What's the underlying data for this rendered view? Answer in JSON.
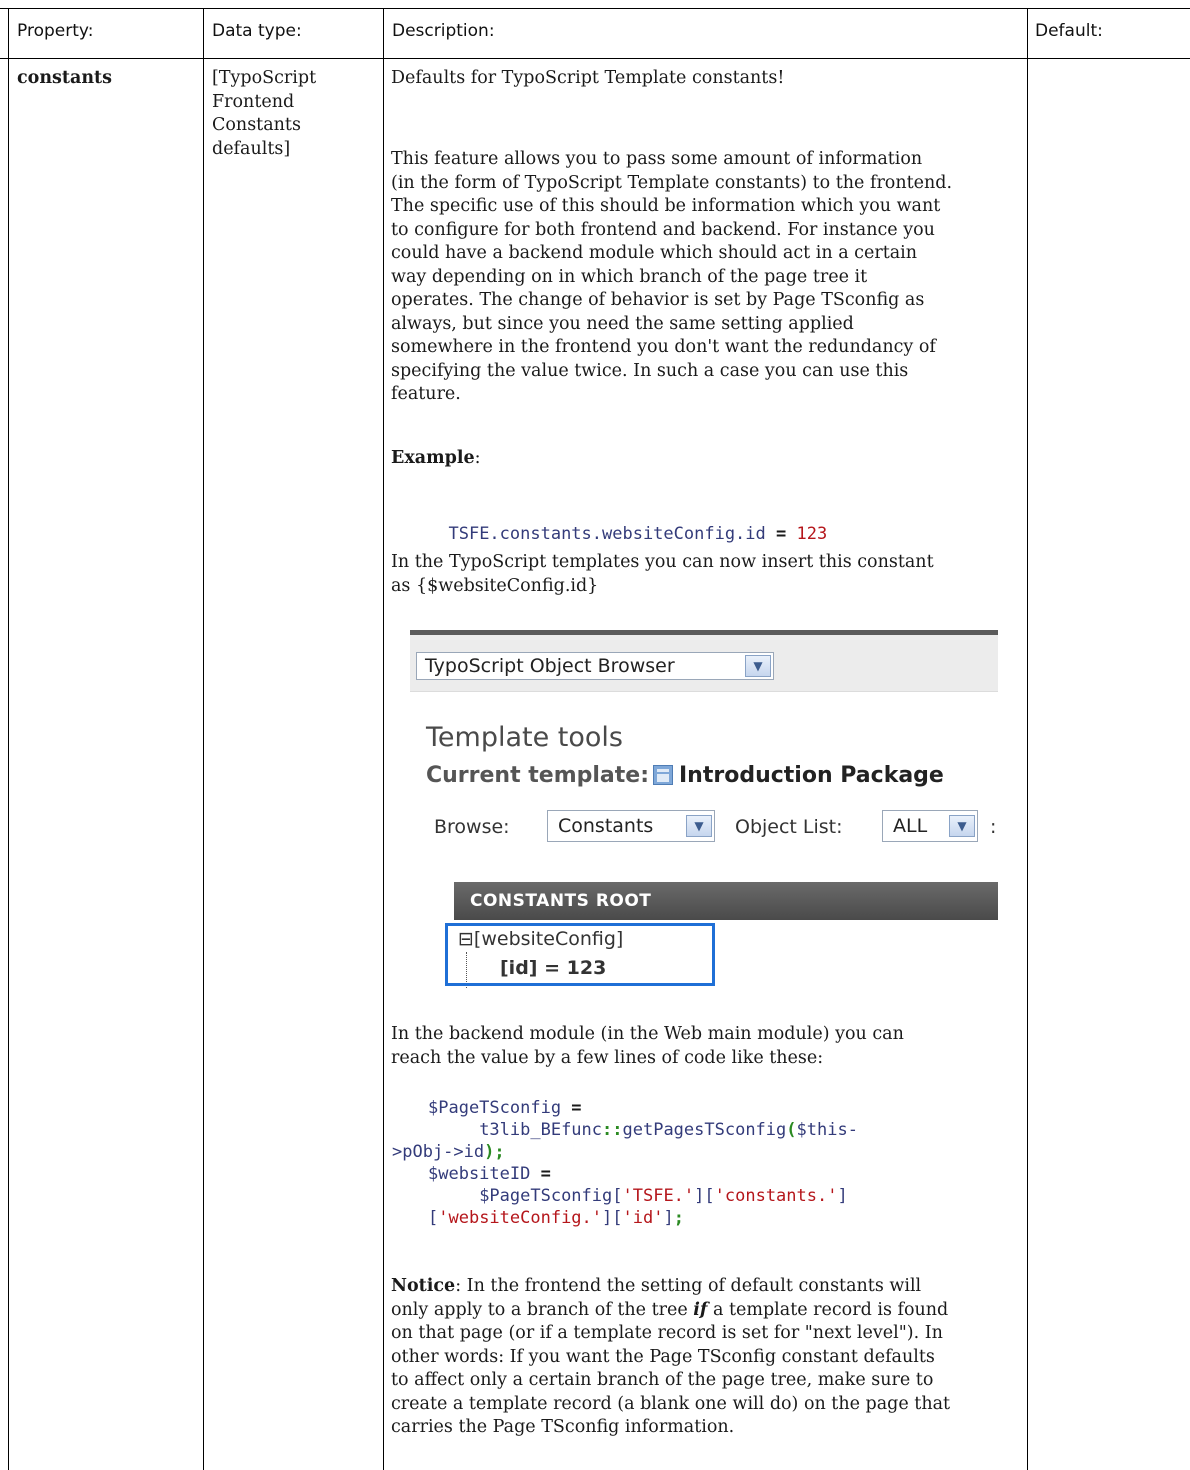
{
  "headers": {
    "property": "Property:",
    "datatype": "Data type:",
    "description": "Description:",
    "default": "Default:"
  },
  "row": {
    "property": "constants",
    "datatype_lines": [
      "[TypoScript",
      "Frontend",
      "Constants",
      "defaults]"
    ],
    "p1": "Defaults for TypoScript Template constants!",
    "p2_lines": [
      "This feature allows you to pass some amount of information",
      "(in the form of TypoScript Template constants) to the frontend.",
      "The specific use of this should be information which you want",
      "to configure for both frontend and backend. For instance you",
      "could have a backend module which should act in a certain",
      "way depending on in which branch of the page tree it",
      "operates. The change of behavior is set by Page TSconfig as",
      "always, but since you need the same setting applied",
      "somewhere in the frontend you don't want the redundancy of",
      "specifying the value twice. In such a case you can use this",
      "feature."
    ],
    "example_label": "Example",
    "example_colon": ":",
    "code1": {
      "key": "TSFE.constants.websiteConfig.id",
      "op": " = ",
      "value": "123"
    },
    "p3_lines": [
      "In the TypoScript templates you can now insert this constant",
      "as {$websiteConfig.id}"
    ],
    "p4_lines": [
      "In the backend module (in the Web main module) you can",
      "reach the value by a few lines of code like these:"
    ],
    "code2": {
      "l1_var": "$PageTSconfig",
      "l1_op": " =",
      "l2_indent": "     ",
      "l2_fn": "t3lib_BEfunc",
      "l2_sep": "::",
      "l2_method": "getPagesTSconfig",
      "l2_paren": "(",
      "l2_arg": "$this-",
      "l3_arg": ">pObj->id",
      "l3_end": ");",
      "l4_var": "$websiteID",
      "l4_op": " =",
      "l5_indent": "     ",
      "l5_var": "$PageTSconfig",
      "l5_k1": "'TSFE.'",
      "l5_k2": "'constants.'",
      "l6_k3": "'websiteConfig.'",
      "l6_k4": "'id'",
      "l6_end": ";"
    },
    "notice_label": "Notice",
    "notice_line1": ": In the frontend the setting of default constants will",
    "notice_line2_a": "only apply to a branch of the tree ",
    "notice_line2_if": "if",
    "notice_line2_b": " a template record is found",
    "notice_lines_rest": [
      "on that page (or if a template record is set for \"next level\"). In",
      "other words: If you want the Page TSconfig constant defaults",
      "to affect only a certain branch of the page tree, make sure to",
      "create a template record (a blank one will do) on the page that",
      "carries the Page TSconfig information."
    ]
  },
  "screenshot": {
    "module_select": "TypoScript Object Browser",
    "title": "Template tools",
    "current_template_label": "Current template:",
    "current_template_value": "Introduction Package",
    "browse_label": "Browse:",
    "browse_value": "Constants",
    "object_list_label": "Object List:",
    "object_list_value": "ALL",
    "trailing": ":",
    "root_label": "CONSTANTS ROOT",
    "tree_node": "[websiteConfig]",
    "tree_leaf": "[id] = 123",
    "icons": [
      "chevron-down-icon",
      "template-icon",
      "tree-collapse-icon"
    ],
    "highlight_color": "#1f6fd6"
  }
}
